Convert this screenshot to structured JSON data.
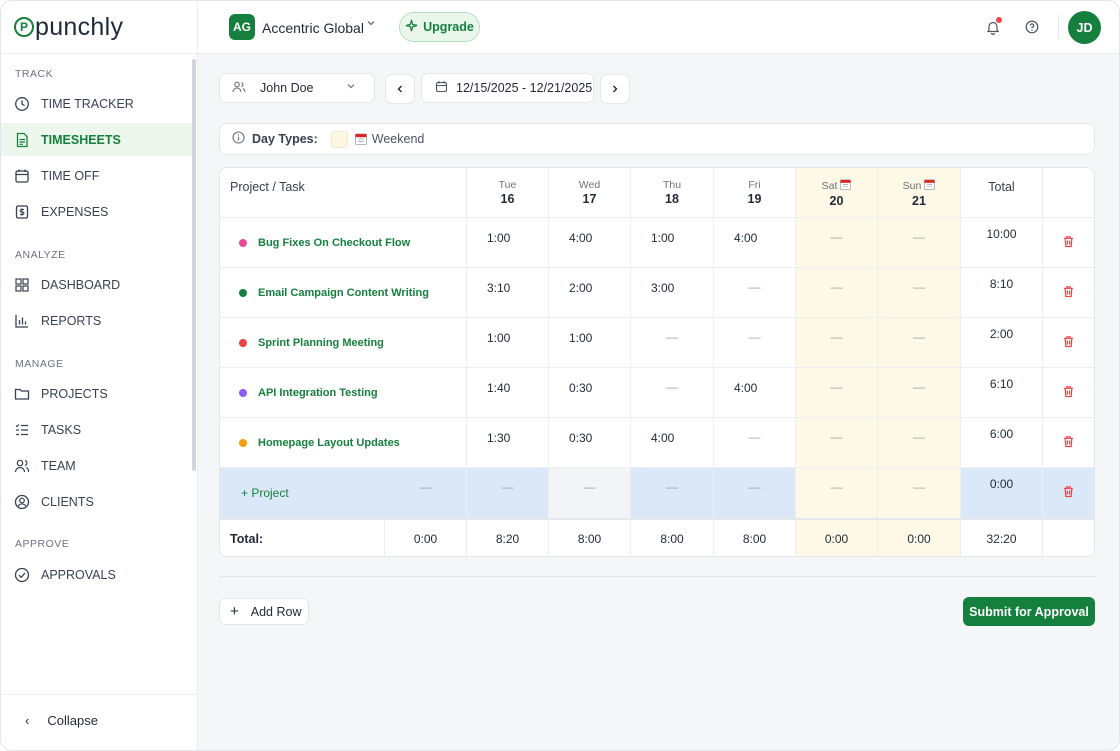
{
  "brand": {
    "name": "punchly",
    "mark": "P"
  },
  "sidebar": {
    "sections": [
      {
        "title": "TRACK",
        "items": [
          {
            "label": "TIME TRACKER",
            "icon": "clock-icon"
          },
          {
            "label": "TIMESHEETS",
            "icon": "timesheet-icon",
            "active": true
          },
          {
            "label": "TIME OFF",
            "icon": "calendar-icon"
          },
          {
            "label": "EXPENSES",
            "icon": "dollar-icon"
          }
        ]
      },
      {
        "title": "ANALYZE",
        "items": [
          {
            "label": "DASHBOARD",
            "icon": "grid-icon"
          },
          {
            "label": "REPORTS",
            "icon": "bar-chart-icon"
          }
        ]
      },
      {
        "title": "MANAGE",
        "items": [
          {
            "label": "PROJECTS",
            "icon": "folder-icon"
          },
          {
            "label": "TASKS",
            "icon": "list-icon"
          },
          {
            "label": "TEAM",
            "icon": "users-icon"
          },
          {
            "label": "CLIENTS",
            "icon": "user-circle-icon"
          }
        ]
      },
      {
        "title": "APPROVE",
        "items": [
          {
            "label": "APPROVALS",
            "icon": "check-circle-icon"
          }
        ]
      }
    ],
    "collapse_label": "Collapse"
  },
  "topbar": {
    "org_initials": "AG",
    "org_name": "Accentric Global",
    "upgrade_label": "Upgrade",
    "user_initials": "JD"
  },
  "controls": {
    "user": "John Doe",
    "date_range": "12/15/2025 - 12/21/2025"
  },
  "day_types": {
    "label": "Day Types:",
    "weekend_label": "Weekend"
  },
  "table": {
    "header_task": "Project / Task",
    "header_total": "Total",
    "days": [
      {
        "name": "Tue",
        "date": "16",
        "weekend": false
      },
      {
        "name": "Wed",
        "date": "17",
        "weekend": false
      },
      {
        "name": "Thu",
        "date": "18",
        "weekend": false
      },
      {
        "name": "Fri",
        "date": "19",
        "weekend": false
      },
      {
        "name": "Sat",
        "date": "20",
        "weekend": true
      },
      {
        "name": "Sun",
        "date": "21",
        "weekend": true
      }
    ],
    "rows": [
      {
        "task": "Bug Fixes On Checkout Flow",
        "color": "#ec4899",
        "hours": [
          "1:00",
          "4:00",
          "1:00",
          "4:00",
          "—",
          "—"
        ],
        "total": "10:00"
      },
      {
        "task": "Email Campaign Content Writing",
        "color": "#15803d",
        "hours": [
          "3:10",
          "2:00",
          "3:00",
          "—",
          "—",
          "—"
        ],
        "total": "8:10"
      },
      {
        "task": "Sprint Planning Meeting",
        "color": "#ef4444",
        "hours": [
          "1:00",
          "1:00",
          "—",
          "—",
          "—",
          "—"
        ],
        "total": "2:00"
      },
      {
        "task": "API Integration Testing",
        "color": "#8b5cf6",
        "hours": [
          "1:40",
          "0:30",
          "—",
          "4:00",
          "—",
          "—"
        ],
        "total": "6:10"
      },
      {
        "task": "Homepage Layout Updates",
        "color": "#f59e0b",
        "hours": [
          "1:30",
          "0:30",
          "4:00",
          "—",
          "—",
          "—"
        ],
        "total": "6:00"
      }
    ],
    "add_project_label": "Project",
    "add_project_cells": [
      "—",
      "—",
      "—",
      "—",
      "—",
      "—",
      "—"
    ],
    "add_project_total": "0:00",
    "totals_label": "Total:",
    "totals": [
      "0:00",
      "8:20",
      "8:00",
      "8:00",
      "8:00",
      "0:00",
      "0:00"
    ],
    "grand_total": "32:20"
  },
  "footer": {
    "add_row_label": "Add Row",
    "submit_label": "Submit for Approval"
  },
  "colors": {
    "brand": "#15803d",
    "weekend_bg": "#fdf9e6",
    "add_row_bg": "#dbe8f8",
    "danger": "#ef4444"
  }
}
